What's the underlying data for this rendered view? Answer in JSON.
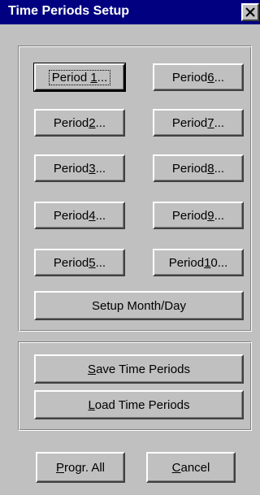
{
  "window": {
    "title": "Time Periods Setup"
  },
  "periods": [
    {
      "prefix": "Period ",
      "key": "1",
      "suffix": "..."
    },
    {
      "prefix": "Period ",
      "key": "6",
      "suffix": "..."
    },
    {
      "prefix": "Period ",
      "key": "2",
      "suffix": "..."
    },
    {
      "prefix": "Period ",
      "key": "7",
      "suffix": "..."
    },
    {
      "prefix": "Period ",
      "key": "3",
      "suffix": "..."
    },
    {
      "prefix": "Period ",
      "key": "8",
      "suffix": "..."
    },
    {
      "prefix": "Period ",
      "key": "4",
      "suffix": "..."
    },
    {
      "prefix": "Period ",
      "key": "9",
      "suffix": "..."
    },
    {
      "prefix": "Period ",
      "key": "5",
      "suffix": "..."
    },
    {
      "prefix": "Period ",
      "key": "1",
      "rest": "0",
      "suffix": "..."
    }
  ],
  "setup_month_day": "Setup Month/Day",
  "save": {
    "key": "S",
    "rest": "ave Time Periods"
  },
  "load": {
    "key": "L",
    "rest": "oad Time Periods"
  },
  "progr_all": {
    "key": "P",
    "rest": "rogr. All"
  },
  "cancel": {
    "key": "C",
    "rest": "ancel"
  }
}
